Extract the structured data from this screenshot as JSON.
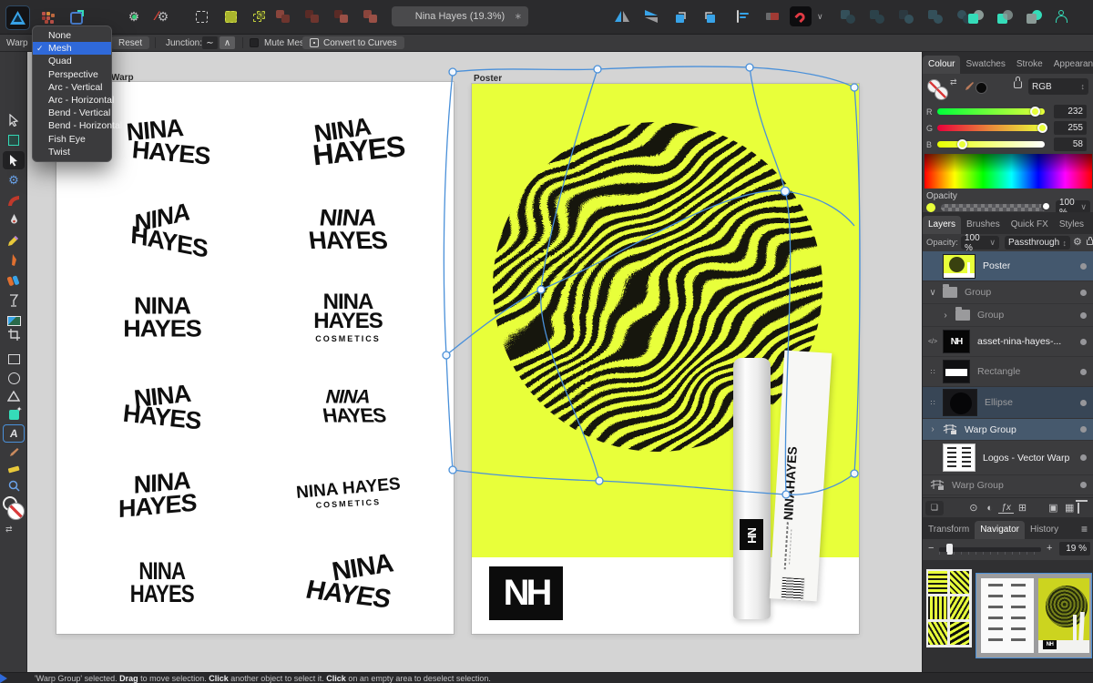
{
  "window": {
    "doc_tab": "Nina Hayes (19.3%)"
  },
  "context_toolbar": {
    "warp_label": "Warp",
    "reset": "Reset",
    "junction": "Junction:",
    "mute_mesh": "Mute Mesh",
    "convert_to_curves": "Convert to Curves"
  },
  "warp_menu": {
    "items": [
      {
        "label": "None",
        "selected": false
      },
      {
        "label": "Mesh",
        "selected": true
      },
      {
        "label": "Quad",
        "selected": false
      },
      {
        "label": "Perspective",
        "selected": false
      },
      {
        "label": "Arc - Vertical",
        "selected": false
      },
      {
        "label": "Arc - Horizontal",
        "selected": false
      },
      {
        "label": "Bend - Vertical",
        "selected": false
      },
      {
        "label": "Bend - Horizontal",
        "selected": false
      },
      {
        "label": "Fish Eye",
        "selected": false
      },
      {
        "label": "Twist",
        "selected": false
      }
    ]
  },
  "artboards": {
    "logos_label": "Warp",
    "poster_label": "Poster",
    "cells": [
      {
        "l1": "NINA",
        "l2": "HAYES"
      },
      {
        "l1": "NINA",
        "l2": "HAYES"
      },
      {
        "l1": "NINA",
        "l2": "HAYES"
      },
      {
        "l1": "NINA",
        "l2": "HAYES"
      },
      {
        "l1": "NINA",
        "l2": "HAYES"
      },
      {
        "l1": "NINA",
        "l2": "HAYES",
        "sub": "COSMETICS"
      },
      {
        "l1": "NINA",
        "l2": "HAYES"
      },
      {
        "l1": "NINA",
        "l2": "HAYES"
      },
      {
        "l1": "NINA",
        "l2": "HAYES"
      },
      {
        "l1": "NINA HAYES",
        "sub": "COSMETICS"
      },
      {
        "l1": "NINA",
        "l2": "HAYES"
      },
      {
        "l1": "NINA",
        "l2": "HAYES"
      }
    ],
    "poster": {
      "monogram": "NH",
      "tube_monogram": "NH",
      "box_line1": "NINA",
      "box_line2": "HAYES"
    }
  },
  "colour_panel": {
    "tabs": [
      "Colour",
      "Swatches",
      "Stroke",
      "Appearance"
    ],
    "mode": "RGB",
    "channels": [
      {
        "label": "R",
        "value": "232"
      },
      {
        "label": "G",
        "value": "255"
      },
      {
        "label": "B",
        "value": "58"
      }
    ],
    "opacity_label": "Opacity",
    "opacity_value": "100 %",
    "fill_hex": "#E8FF3A"
  },
  "layers_panel": {
    "tabs": [
      "Layers",
      "Brushes",
      "Quick FX",
      "Styles"
    ],
    "opacity_label": "Opacity:",
    "opacity_value": "100 %",
    "blend_mode": "Passthrough",
    "nh_thumb": "NH",
    "rows": [
      {
        "label": "Poster"
      },
      {
        "label": "Group"
      },
      {
        "label": "Group"
      },
      {
        "label": "asset-nina-hayes-..."
      },
      {
        "label": "Rectangle"
      },
      {
        "label": "Ellipse"
      },
      {
        "label": "Warp Group"
      },
      {
        "label": "Logos - Vector Warp"
      },
      {
        "label": "Warp Group"
      }
    ]
  },
  "bottom_panel": {
    "tabs": [
      "Transform",
      "Navigator",
      "History"
    ],
    "zoom_value": "19 %"
  },
  "status_bar": {
    "s1": "'Warp Group' selected. ",
    "b1": "Drag",
    "s2": " to move selection. ",
    "b2": "Click",
    "s3": " another object to select it. ",
    "b3": "Click",
    "s4": " on an empty area to deselect selection."
  },
  "icons": {
    "hamburger": "≡",
    "chevron_down": "∨",
    "chevron_right": "›",
    "check": "✓",
    "modified": "∗",
    "swap": "⇄",
    "updown": "↕",
    "gear": "⚙",
    "fx": "ƒx",
    "code": "</>",
    "dots": "∷",
    "mask": "⊙",
    "adjustment": "◐",
    "mesh": "⊞",
    "add_layer": "▣",
    "blend_ranges": "▦",
    "plus": "+",
    "minus": "−",
    "junction_smooth": "∼",
    "junction_sharp": "∧"
  },
  "colors": {
    "accent_yellow": "#E8FF3A",
    "selection_blue": "#2F69D9",
    "layer_selected_bg": "#44586E",
    "node_blue": "#4A90D9"
  }
}
